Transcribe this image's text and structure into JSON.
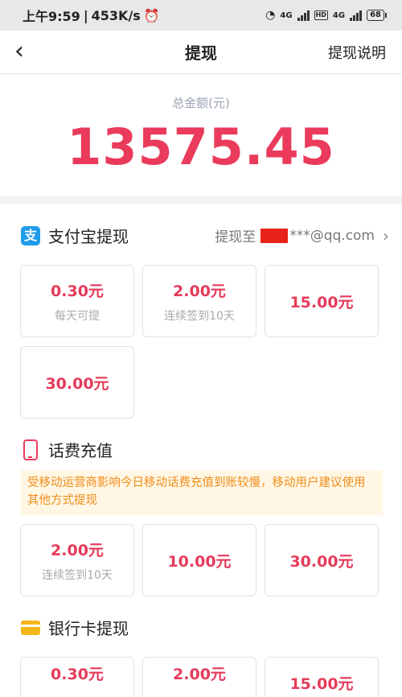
{
  "status_bar": {
    "time": "上午9:59",
    "speed": "453K/s",
    "net1": "4G",
    "hd": "HD",
    "net2": "4G",
    "battery": "68"
  },
  "nav": {
    "back": "‹",
    "title": "提现",
    "help": "提现说明"
  },
  "balance": {
    "label": "总金额(元)",
    "amount": "13575.45"
  },
  "alipay": {
    "icon": "alipay-icon",
    "title": "支付宝提现",
    "dest_prefix": "提现至",
    "dest_suffix": "***@qq.com",
    "options": [
      {
        "amount": "0.30元",
        "note": "每天可提"
      },
      {
        "amount": "2.00元",
        "note": "连续签到10天"
      },
      {
        "amount": "15.00元"
      },
      {
        "amount": "30.00元"
      }
    ]
  },
  "phone": {
    "icon": "phone-icon",
    "title": "话费充值",
    "notice": "受移动运营商影响今日移动话费充值到账较慢，移动用户建议使用其他方式提现",
    "options": [
      {
        "amount": "2.00元",
        "note": "连续签到10天"
      },
      {
        "amount": "10.00元"
      },
      {
        "amount": "30.00元"
      }
    ]
  },
  "bank": {
    "icon": "bank-card-icon",
    "title": "银行卡提现",
    "options": [
      {
        "amount": "0.30元"
      },
      {
        "amount": "2.00元"
      },
      {
        "amount": "15.00元"
      }
    ]
  },
  "colors": {
    "accent": "#ea3b5c",
    "alipay": "#1e9cea",
    "card": "#f5b619",
    "notice_text": "#f08c1a",
    "notice_bg": "#fff7e4"
  }
}
